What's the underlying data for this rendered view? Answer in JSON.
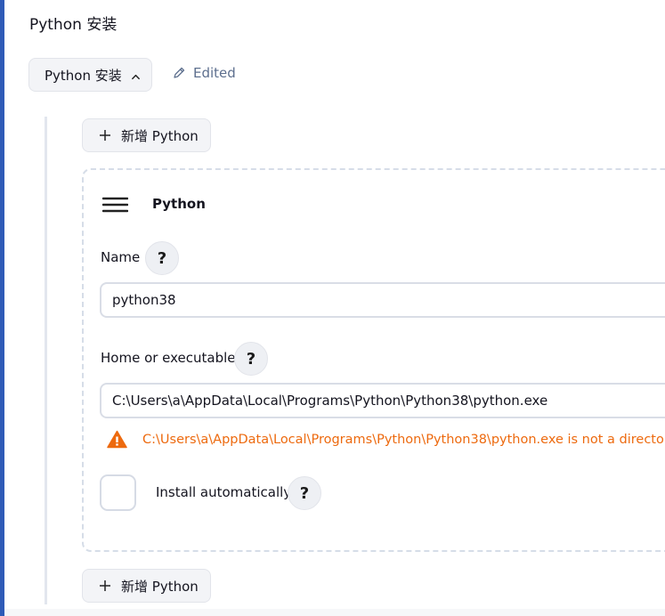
{
  "section": {
    "title": "Python 安装"
  },
  "toolbar": {
    "collapse_label": "Python 安装",
    "edited_label": "Edited"
  },
  "installations": {
    "add_label": "新增 Python",
    "card": {
      "title": "Python",
      "name_label": "Name",
      "name_value": "python38",
      "home_label": "Home or executable",
      "home_value": "C:\\Users\\a\\AppData\\Local\\Programs\\Python\\Python38\\python.exe",
      "warning": "C:\\Users\\a\\AppData\\Local\\Programs\\Python\\Python38\\python.exe is not a directory",
      "install_auto_label": "Install automatically",
      "install_auto_checked": false
    },
    "help_glyph": "?"
  },
  "colors": {
    "accent": "#2f5bb7",
    "warning": "#ed6a0f",
    "muted": "#5d6f8e"
  },
  "icons": [
    "chevron-up-icon",
    "pencil-icon",
    "plus-icon",
    "drag-handle-icon",
    "help-icon",
    "warning-icon"
  ]
}
